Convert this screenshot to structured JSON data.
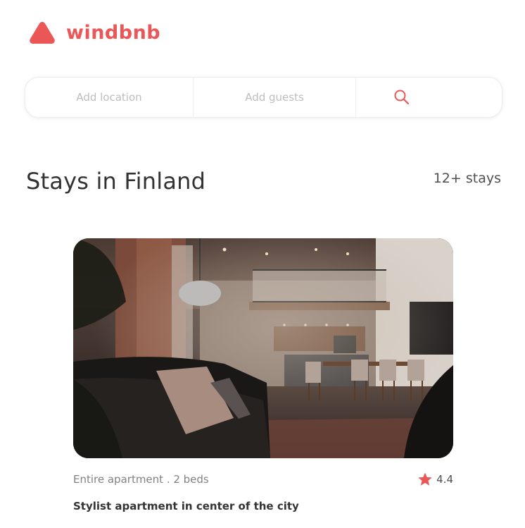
{
  "brand": {
    "name": "windbnb",
    "color": "#eb5757",
    "icon": "logo-triangle-icon"
  },
  "search": {
    "location_placeholder": "Add location",
    "guests_placeholder": "Add guests",
    "icon": "search-icon"
  },
  "heading": {
    "title": "Stays in Finland",
    "count": "12+ stays"
  },
  "stays": [
    {
      "type": "Entire apartment . 2 beds",
      "rating": "4.4",
      "title": "Stylist apartment in center of the city",
      "rating_icon": "star-icon",
      "rating_color": "#eb5757"
    }
  ]
}
